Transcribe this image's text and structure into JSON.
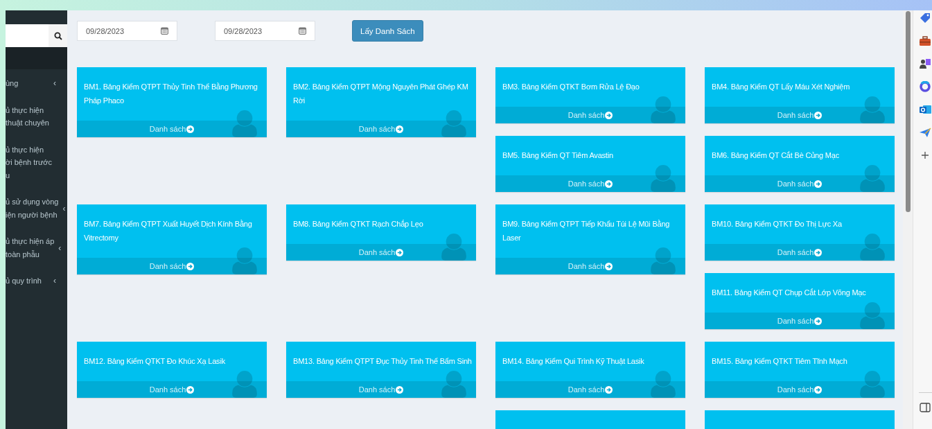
{
  "sidebar": {
    "items": [
      {
        "lines": [
          "ùng"
        ],
        "chevron": "‹"
      },
      {
        "lines": [
          "ủ thực hiện",
          "thuật chuyên"
        ]
      },
      {
        "lines": [
          "ủ thực hiện",
          "ời bệnh trước",
          "u"
        ]
      },
      {
        "lines": [
          "ủ sử dụng vòng",
          "iện người bệnh"
        ],
        "chevron": "‹"
      },
      {
        "lines": [
          "ủ thực hiện áp",
          "toàn phẫu"
        ],
        "chevron": "‹"
      },
      {
        "lines": [
          "ủ quy trình"
        ],
        "chevron": "‹"
      }
    ]
  },
  "filters": {
    "from_date": "09/28/2023",
    "to_date": "09/28/2023",
    "button": "Lấy Danh Sách"
  },
  "rows": [
    {
      "columns": [
        [
          {
            "kind": "card",
            "title": "BM1. Bảng Kiểm QTPT Thủy Tinh Thể Bằng Phương Pháp Phaco",
            "link": "Danh sách"
          }
        ],
        [
          {
            "kind": "card",
            "title": "BM2. Bảng Kiểm QTPT Mộng Nguyên Phát Ghép KM Rời",
            "link": "Danh sách"
          }
        ],
        [
          {
            "kind": "card",
            "title": "BM3. Bảng Kiểm QTKT Bơm Rửa Lệ Đạo",
            "link": "Danh sách"
          },
          {
            "kind": "card",
            "title": "BM5. Bảng Kiểm QT Tiêm Avastin",
            "link": "Danh sách"
          }
        ],
        [
          {
            "kind": "card",
            "title": "BM4. Bảng Kiểm QT Lấy Máu Xét Nghiệm",
            "link": "Danh sách"
          },
          {
            "kind": "card",
            "title": "BM6. Bảng Kiểm QT Cắt Bè Củng Mạc",
            "link": "Danh sách"
          }
        ]
      ]
    },
    {
      "columns": [
        [
          {
            "kind": "card",
            "title": "BM7. Bảng Kiểm QTPT Xuất Huyết Dịch Kính Bằng Vitrectomy",
            "link": "Danh sách"
          }
        ],
        [
          {
            "kind": "card",
            "title": "BM8. Bảng Kiểm QTKT Rạch Chắp Lẹo",
            "link": "Danh sách"
          }
        ],
        [
          {
            "kind": "card",
            "title": "BM9. Bảng Kiểm QTPT Tiếp Khẩu Túi Lệ Mũi Bằng Laser",
            "link": "Danh sách"
          }
        ],
        [
          {
            "kind": "card",
            "title": "BM10. Bảng Kiểm QTKT Đo Thị Lực Xa",
            "link": "Danh sách"
          },
          {
            "kind": "card",
            "title": "BM11. Bảng Kiểm QT Chụp Cắt Lớp Võng Mạc",
            "link": "Danh sách"
          }
        ]
      ]
    },
    {
      "columns": [
        [
          {
            "kind": "card",
            "title": "BM12. Bảng Kiểm QTKT Đo Khúc Xạ Lasik",
            "link": "Danh sách"
          }
        ],
        [
          {
            "kind": "card",
            "title": "BM13. Bảng Kiểm QTPT Đục Thủy Tinh Thể Bẩm Sinh",
            "link": "Danh sách"
          }
        ],
        [
          {
            "kind": "card",
            "title": "BM14. Bảng Kiểm Qui Trình Kỹ Thuật Lasik",
            "link": "Danh sách"
          },
          {
            "kind": "partial"
          }
        ],
        [
          {
            "kind": "card",
            "title": "BM15. Bảng Kiểm QTKT Tiêm Tĩnh Mạch",
            "link": "Danh sách"
          },
          {
            "kind": "partial"
          }
        ]
      ]
    }
  ]
}
